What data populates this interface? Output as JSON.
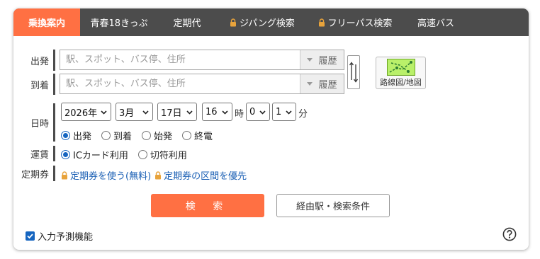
{
  "tabs": [
    {
      "label": "乗換案内",
      "active": true,
      "locked": false
    },
    {
      "label": "青春18きっぷ",
      "active": false,
      "locked": false
    },
    {
      "label": "定期代",
      "active": false,
      "locked": false
    },
    {
      "label": "ジパング検索",
      "active": false,
      "locked": true
    },
    {
      "label": "フリーパス検索",
      "active": false,
      "locked": true
    },
    {
      "label": "高速バス",
      "active": false,
      "locked": false
    }
  ],
  "from": {
    "label": "出発",
    "placeholder": "駅、スポット、バス停、住所",
    "history_label": "履歴"
  },
  "to": {
    "label": "到着",
    "placeholder": "駅、スポット、バス停、住所",
    "history_label": "履歴"
  },
  "map_button": {
    "label": "路線図/地図",
    "icon": "route-map-icon"
  },
  "datetime": {
    "label": "日時",
    "year": "2026年",
    "month": "3月",
    "day": "17日",
    "hour": "16",
    "hour_unit": "時",
    "min_tens": "0",
    "min_ones": "1",
    "min_unit": "分",
    "modes": [
      {
        "label": "出発",
        "checked": true
      },
      {
        "label": "到着",
        "checked": false
      },
      {
        "label": "始発",
        "checked": false
      },
      {
        "label": "終電",
        "checked": false
      }
    ]
  },
  "fare": {
    "label": "運賃",
    "options": [
      {
        "label": "ICカード利用",
        "checked": true
      },
      {
        "label": "切符利用",
        "checked": false
      }
    ]
  },
  "commuter": {
    "label": "定期券",
    "link1": "定期券を使う(無料)",
    "link2": "定期券の区間を優先"
  },
  "search_button": "検 索",
  "conditions_button": "経由駅・検索条件",
  "predict": {
    "label": "入力予測機能",
    "checked": true
  },
  "colors": {
    "accent": "#ff7043",
    "tabbar": "#4c4c4c",
    "link": "#1a5fb4",
    "radio": "#1565c0"
  }
}
